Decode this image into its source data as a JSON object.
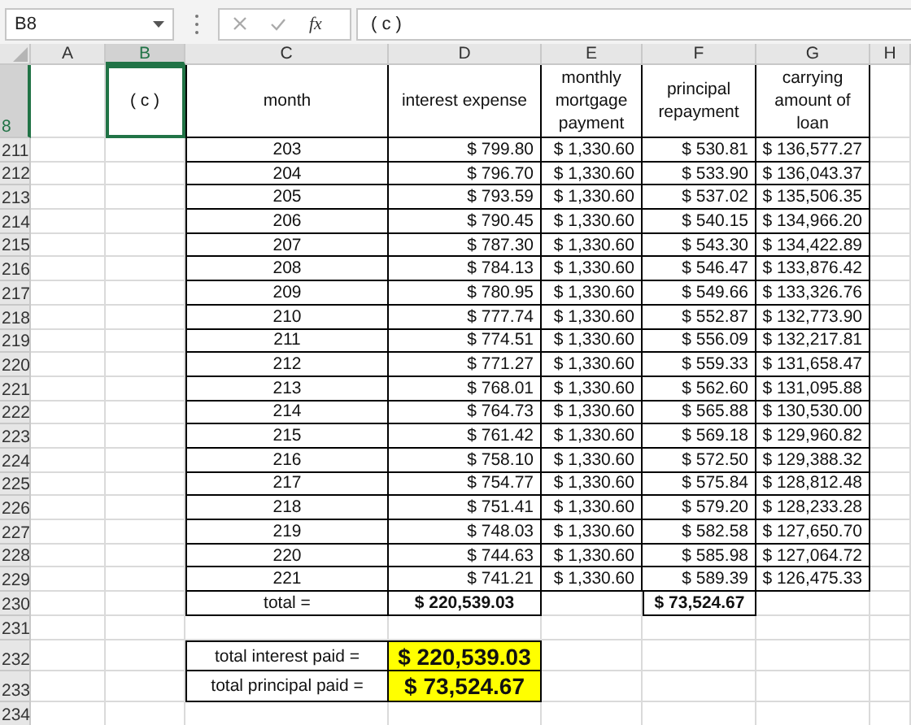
{
  "name_box": {
    "value": "B8"
  },
  "formula_bar": {
    "function_label": "fx",
    "value": "( c )"
  },
  "columns": [
    {
      "label": "A",
      "selected": false
    },
    {
      "label": "B",
      "selected": true
    },
    {
      "label": "C",
      "selected": false
    },
    {
      "label": "D",
      "selected": false
    },
    {
      "label": "E",
      "selected": false
    },
    {
      "label": "F",
      "selected": false
    },
    {
      "label": "G",
      "selected": false
    },
    {
      "label": "H",
      "selected": false
    }
  ],
  "rows": [
    {
      "kind": "header",
      "number": "8",
      "selected": true,
      "label": "( c )",
      "cells": [
        "month",
        "interest expense",
        "monthly mortgage payment",
        "principal repayment",
        "carrying amount of loan"
      ]
    },
    {
      "kind": "data",
      "number": "211",
      "selected": false,
      "cells": [
        "203",
        "$ 799.80",
        "$ 1,330.60",
        "$ 530.81",
        "$ 136,577.27"
      ]
    },
    {
      "kind": "data",
      "number": "212",
      "selected": false,
      "cells": [
        "204",
        "$ 796.70",
        "$ 1,330.60",
        "$ 533.90",
        "$ 136,043.37"
      ]
    },
    {
      "kind": "data",
      "number": "213",
      "selected": false,
      "cells": [
        "205",
        "$ 793.59",
        "$ 1,330.60",
        "$ 537.02",
        "$ 135,506.35"
      ]
    },
    {
      "kind": "data",
      "number": "214",
      "selected": false,
      "cells": [
        "206",
        "$ 790.45",
        "$ 1,330.60",
        "$ 540.15",
        "$ 134,966.20"
      ]
    },
    {
      "kind": "data",
      "number": "215",
      "selected": false,
      "cells": [
        "207",
        "$ 787.30",
        "$ 1,330.60",
        "$ 543.30",
        "$ 134,422.89"
      ]
    },
    {
      "kind": "data",
      "number": "216",
      "selected": false,
      "cells": [
        "208",
        "$ 784.13",
        "$ 1,330.60",
        "$ 546.47",
        "$ 133,876.42"
      ]
    },
    {
      "kind": "data",
      "number": "217",
      "selected": false,
      "cells": [
        "209",
        "$ 780.95",
        "$ 1,330.60",
        "$ 549.66",
        "$ 133,326.76"
      ]
    },
    {
      "kind": "data",
      "number": "218",
      "selected": false,
      "cells": [
        "210",
        "$ 777.74",
        "$ 1,330.60",
        "$ 552.87",
        "$ 132,773.90"
      ]
    },
    {
      "kind": "data",
      "number": "219",
      "selected": false,
      "cells": [
        "211",
        "$ 774.51",
        "$ 1,330.60",
        "$ 556.09",
        "$ 132,217.81"
      ]
    },
    {
      "kind": "data",
      "number": "220",
      "selected": false,
      "cells": [
        "212",
        "$ 771.27",
        "$ 1,330.60",
        "$ 559.33",
        "$ 131,658.47"
      ]
    },
    {
      "kind": "data",
      "number": "221",
      "selected": false,
      "cells": [
        "213",
        "$ 768.01",
        "$ 1,330.60",
        "$ 562.60",
        "$ 131,095.88"
      ]
    },
    {
      "kind": "data",
      "number": "222",
      "selected": false,
      "cells": [
        "214",
        "$ 764.73",
        "$ 1,330.60",
        "$ 565.88",
        "$ 130,530.00"
      ]
    },
    {
      "kind": "data",
      "number": "223",
      "selected": false,
      "cells": [
        "215",
        "$ 761.42",
        "$ 1,330.60",
        "$ 569.18",
        "$ 129,960.82"
      ]
    },
    {
      "kind": "data",
      "number": "224",
      "selected": false,
      "cells": [
        "216",
        "$ 758.10",
        "$ 1,330.60",
        "$ 572.50",
        "$ 129,388.32"
      ]
    },
    {
      "kind": "data",
      "number": "225",
      "selected": false,
      "cells": [
        "217",
        "$ 754.77",
        "$ 1,330.60",
        "$ 575.84",
        "$ 128,812.48"
      ]
    },
    {
      "kind": "data",
      "number": "226",
      "selected": false,
      "cells": [
        "218",
        "$ 751.41",
        "$ 1,330.60",
        "$ 579.20",
        "$ 128,233.28"
      ]
    },
    {
      "kind": "data",
      "number": "227",
      "selected": false,
      "cells": [
        "219",
        "$ 748.03",
        "$ 1,330.60",
        "$ 582.58",
        "$ 127,650.70"
      ]
    },
    {
      "kind": "data",
      "number": "228",
      "selected": false,
      "cells": [
        "220",
        "$ 744.63",
        "$ 1,330.60",
        "$ 585.98",
        "$ 127,064.72"
      ]
    },
    {
      "kind": "data",
      "number": "229",
      "selected": false,
      "cells": [
        "221",
        "$ 741.21",
        "$ 1,330.60",
        "$ 589.39",
        "$ 126,475.33"
      ]
    },
    {
      "kind": "total",
      "number": "230",
      "selected": false,
      "label": "total =",
      "interest": "$ 220,539.03",
      "principal": "$ 73,524.67"
    },
    {
      "kind": "blank",
      "number": "231",
      "selected": false
    },
    {
      "kind": "summary",
      "number": "232",
      "selected": false,
      "label": "total interest paid =",
      "value": "$ 220,539.03"
    },
    {
      "kind": "summary",
      "number": "233",
      "selected": false,
      "label": "total principal paid =",
      "value": "$ 73,524.67"
    },
    {
      "kind": "blank",
      "number": "234",
      "selected": false
    }
  ]
}
